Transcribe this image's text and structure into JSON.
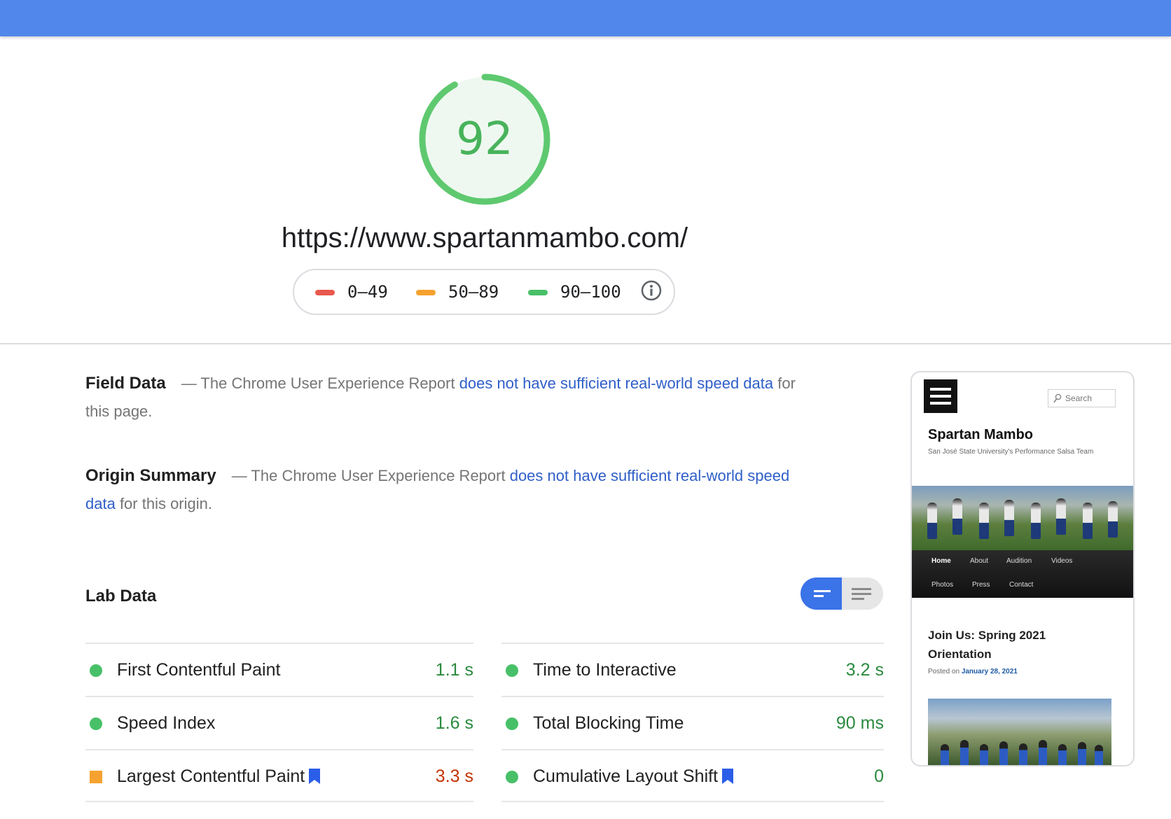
{
  "report": {
    "score": "92",
    "url": "https://www.spartanmambo.com/"
  },
  "legend": {
    "ranges": [
      {
        "label": "0–49",
        "color": "#e8584d"
      },
      {
        "label": "50–89",
        "color": "#f6a230"
      },
      {
        "label": "90–100",
        "color": "#48c068"
      }
    ],
    "info_icon": "info-icon"
  },
  "field_data": {
    "title": "Field Data",
    "prefix": "— The Chrome User Experience Report ",
    "link": "does not have sufficient real-world speed data",
    "suffix": " for this page."
  },
  "origin_summary": {
    "title": "Origin Summary",
    "prefix": "— The Chrome User Experience Report ",
    "link": "does not have sufficient real-world speed data",
    "suffix": " for this origin."
  },
  "lab_data": {
    "title": "Lab Data",
    "toggle": {
      "selected": "summary-view",
      "other": "detailed-view"
    },
    "metrics_left": [
      {
        "label": "First Contentful Paint",
        "value": "1.1 s",
        "status": "pass"
      },
      {
        "label": "Speed Index",
        "value": "1.6 s",
        "status": "pass"
      },
      {
        "label": "Largest Contentful Paint",
        "value": "3.3 s",
        "status": "average"
      }
    ],
    "metrics_right": [
      {
        "label": "Time to Interactive",
        "value": "3.2 s",
        "status": "pass"
      },
      {
        "label": "Total Blocking Time",
        "value": "90 ms",
        "status": "pass"
      },
      {
        "label": "Cumulative Layout Shift",
        "value": "0",
        "status": "pass"
      }
    ]
  },
  "preview": {
    "search_placeholder": "Search",
    "site_title": "Spartan Mambo",
    "tagline": "San José State University's Performance Salsa Team",
    "nav": [
      "Home",
      "About",
      "Audition",
      "Videos",
      "Photos",
      "Press",
      "Contact"
    ],
    "post_title": "Join Us: Spring 2021 Orientation",
    "posted_prefix": "Posted on ",
    "posted_date": "January 28, 2021"
  },
  "colors": {
    "topbar": "#5187eb",
    "pass": "#48c068",
    "average": "#f6a230",
    "fail": "#e8584d",
    "link": "#2f5fc8"
  }
}
